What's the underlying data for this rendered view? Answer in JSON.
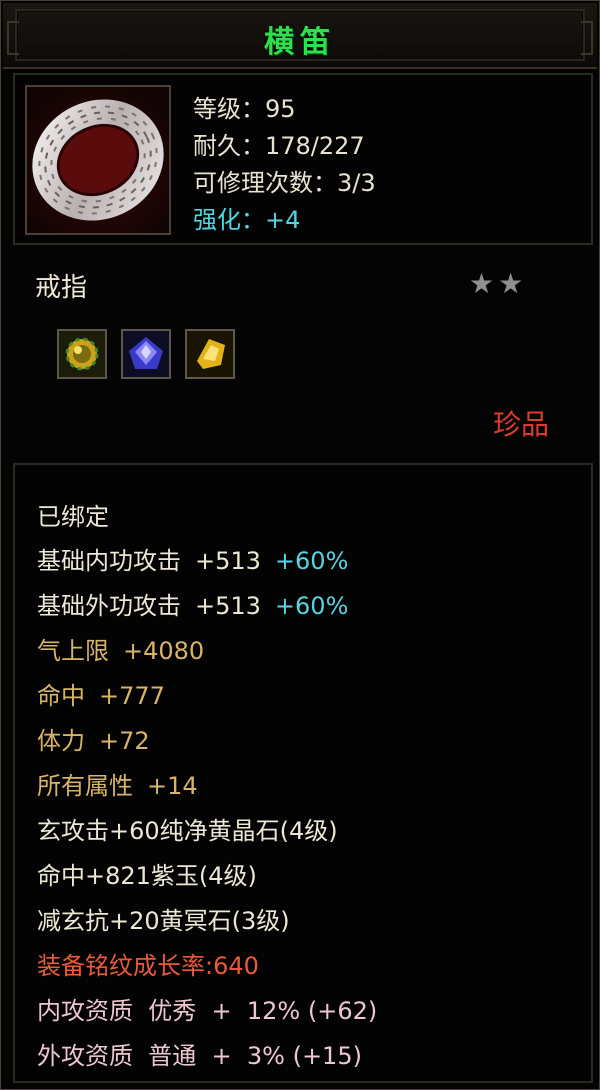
{
  "item": {
    "name": "横笛",
    "level": "等级：95",
    "durability": "耐久：178/227",
    "repairs": "可修理次数：3/3",
    "enhance": "强化：+4",
    "type": "戒指",
    "stars": "★★",
    "rarity": "珍品",
    "icon": "silver-ring-icon",
    "gems": [
      "gold-gem-icon",
      "purple-gem-icon",
      "yellow-gem-icon"
    ]
  },
  "attributes": {
    "bound": "已绑定",
    "inner_attack": {
      "label": "基础内功攻击",
      "value": "+513",
      "bonus": "+60%"
    },
    "outer_attack": {
      "label": "基础外功攻击",
      "value": "+513",
      "bonus": "+60%"
    },
    "qi_limit": {
      "label": "气上限",
      "value": "+4080"
    },
    "hit": {
      "label": "命中",
      "value": "+777"
    },
    "stamina": {
      "label": "体力",
      "value": "+72"
    },
    "all_attributes": {
      "label": "所有属性",
      "value": "+14"
    },
    "gem_lines": [
      "玄攻击+60纯净黄晶石(4级)",
      "命中+821紫玉(4级)",
      "减玄抗+20黄冥石(3级)"
    ],
    "growth": "装备铭纹成长率:640",
    "inner_quality": "内攻资质  优秀  +  12% (+62)",
    "outer_quality": "外攻资质  普通  +  3% (+15)"
  },
  "colors": {
    "title": "#2ee04a",
    "enhance": "#4fd6e2",
    "rarity": "#e03a2a",
    "gold_stat": "#d8b468",
    "growth": "#ea5a38",
    "quality": "#ecc7cf"
  }
}
